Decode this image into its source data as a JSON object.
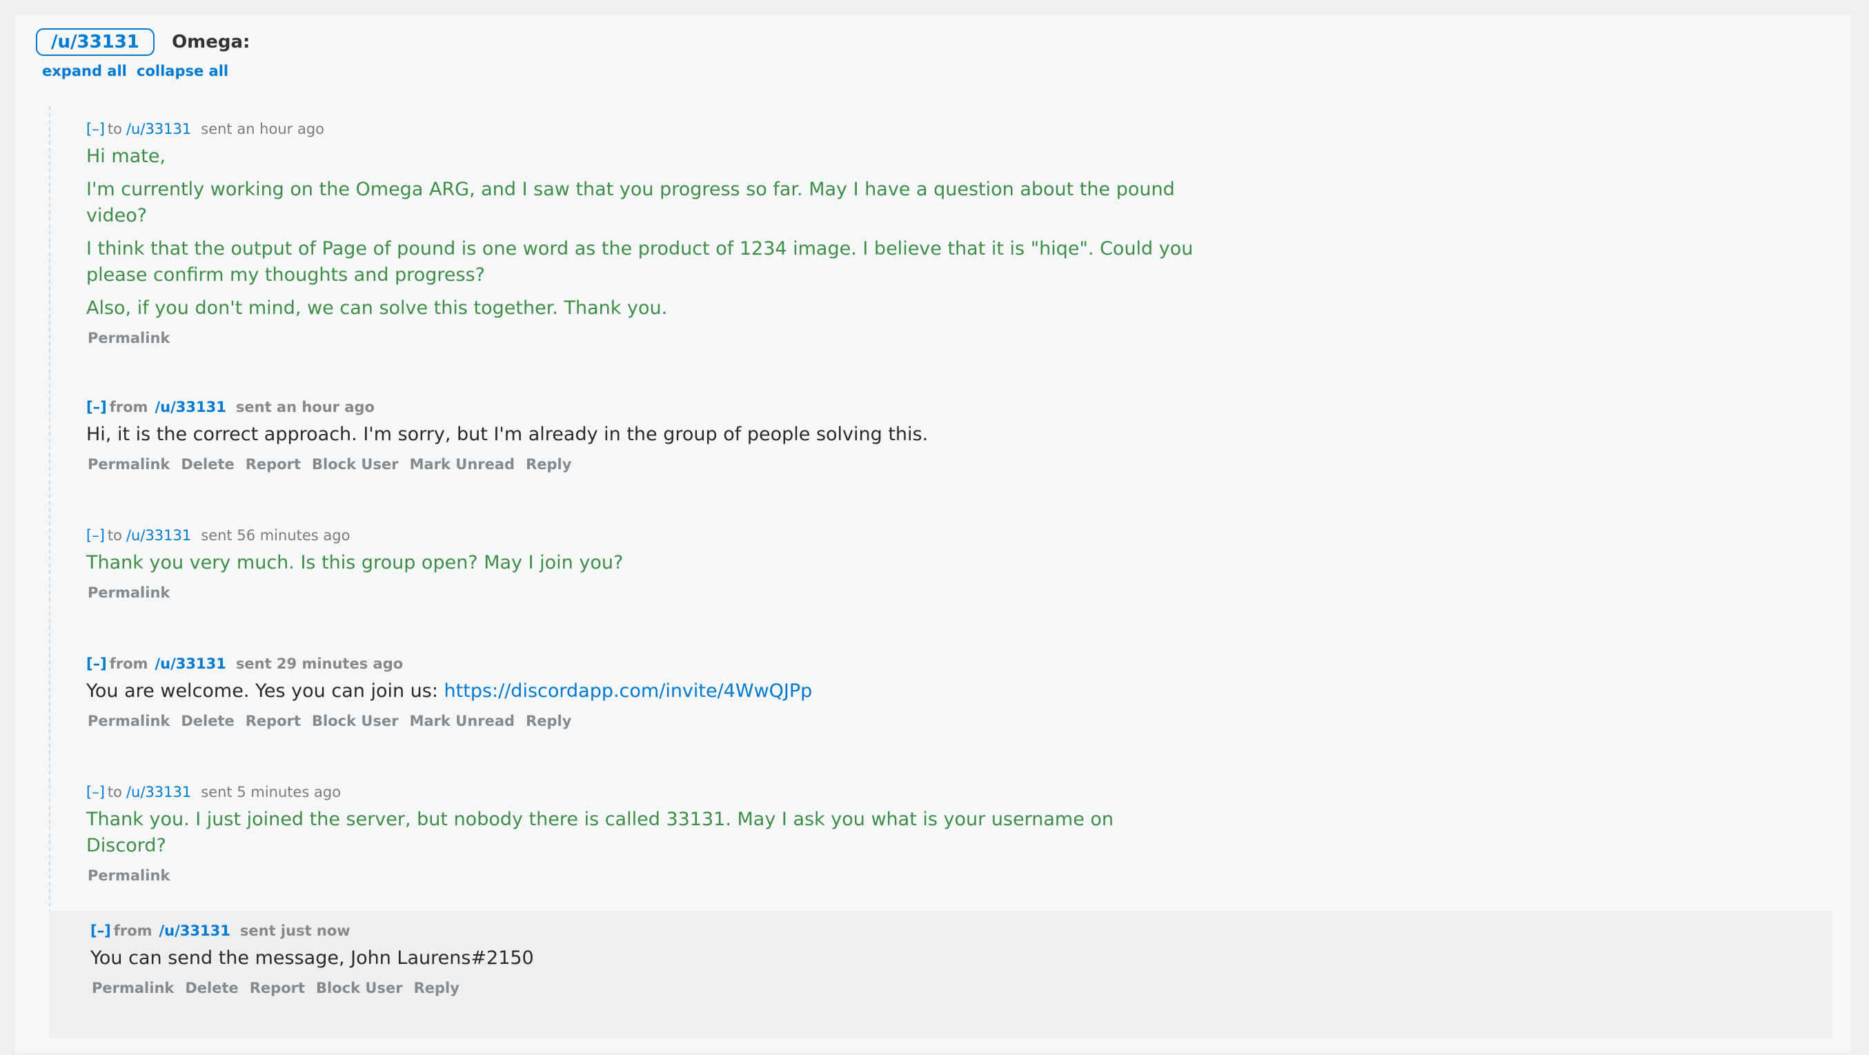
{
  "header": {
    "user_label": "/u/33131",
    "subject": "Omega:",
    "expand_all": "expand all",
    "collapse_all": "collapse all"
  },
  "messages": [
    {
      "toggle": "[–]",
      "direction": "to",
      "user": "/u/33131",
      "time": "sent an hour ago",
      "paragraphs": [
        "Hi mate,",
        "I'm currently working on the Omega ARG, and I saw that you progress so far. May I have a question about the pound video?",
        "I think that the output of Page of pound is one word as the product of 1234 image. I believe that it is \"hiqe\". Could you please confirm my thoughts and progress?",
        "Also, if you don't mind, we can solve this together. Thank you."
      ],
      "actions": [
        "Permalink"
      ]
    },
    {
      "toggle": "[–]",
      "direction": "from",
      "user": "/u/33131",
      "time": "sent an hour ago",
      "paragraphs": [
        "Hi, it is the correct approach. I'm sorry, but I'm already in the group of people solving this."
      ],
      "actions": [
        "Permalink",
        "Delete",
        "Report",
        "Block User",
        "Mark Unread",
        "Reply"
      ]
    },
    {
      "toggle": "[–]",
      "direction": "to",
      "user": "/u/33131",
      "time": "sent 56 minutes ago",
      "paragraphs": [
        "Thank you very much. Is this group open? May I join you?"
      ],
      "actions": [
        "Permalink"
      ]
    },
    {
      "toggle": "[–]",
      "direction": "from",
      "user": "/u/33131",
      "time": "sent 29 minutes ago",
      "text": "You are welcome. Yes you can join us: ",
      "link": "https://discordapp.com/invite/4WwQJPp",
      "actions": [
        "Permalink",
        "Delete",
        "Report",
        "Block User",
        "Mark Unread",
        "Reply"
      ]
    },
    {
      "toggle": "[–]",
      "direction": "to",
      "user": "/u/33131",
      "time": "sent 5 minutes ago",
      "paragraphs": [
        "Thank you. I just joined the server, but nobody there is called 33131. May I ask you what is your username on Discord?"
      ],
      "actions": [
        "Permalink"
      ]
    },
    {
      "toggle": "[–]",
      "direction": "from",
      "user": "/u/33131",
      "time": "sent just now",
      "paragraphs": [
        "You can send the message, John Laurens#2150"
      ],
      "actions": [
        "Permalink",
        "Delete",
        "Report",
        "Block User",
        "Reply"
      ]
    }
  ]
}
